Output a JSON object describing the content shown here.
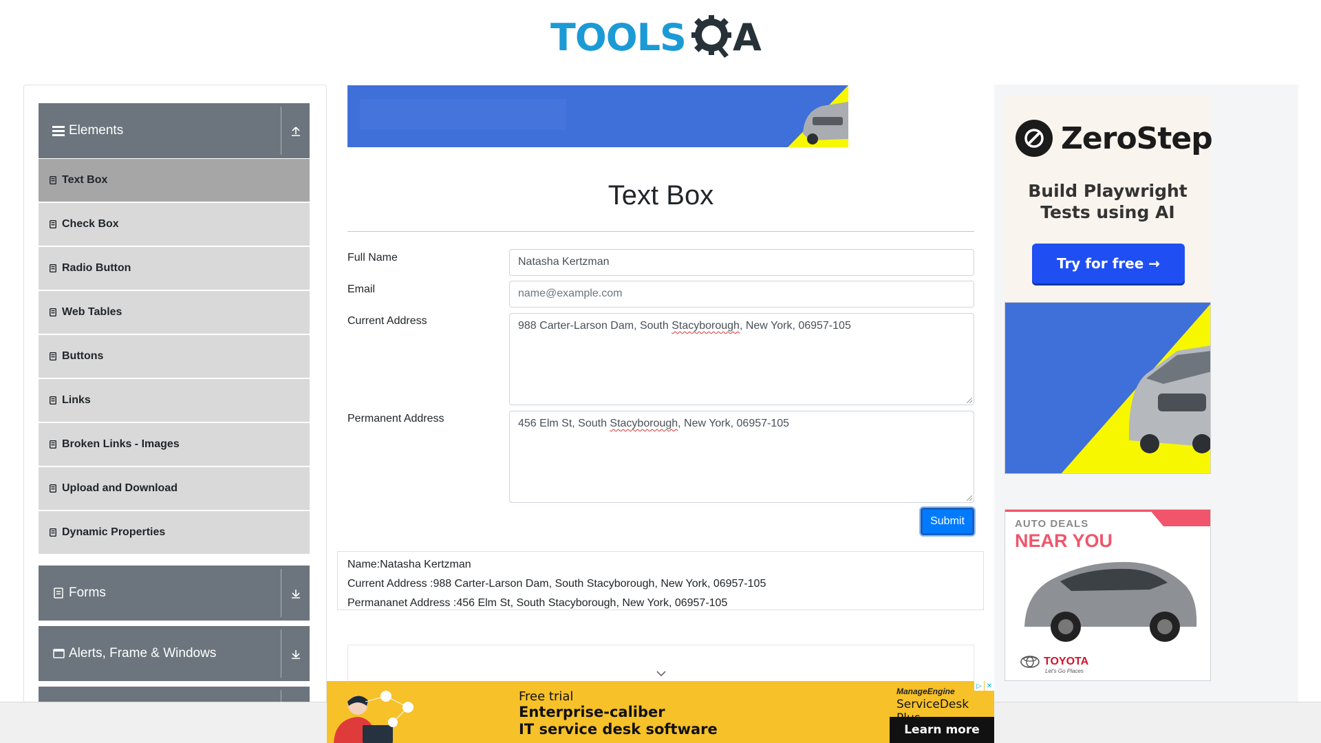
{
  "header": {
    "logo_primary": "TOOLS",
    "logo_secondary": "A",
    "logo_icon": "gear-magnifier-icon"
  },
  "sidebar": {
    "groups": [
      {
        "label": "Elements",
        "icon": "hamburger-icon",
        "toggle_icon": "collapse-up-icon",
        "expanded": true
      },
      {
        "label": "Forms",
        "icon": "document-icon",
        "toggle_icon": "expand-down-icon",
        "expanded": false
      },
      {
        "label": "Alerts, Frame & Windows",
        "icon": "window-icon",
        "toggle_icon": "expand-down-icon",
        "expanded": false
      }
    ],
    "items": [
      {
        "label": "Text Box",
        "active": true
      },
      {
        "label": "Check Box",
        "active": false
      },
      {
        "label": "Radio Button",
        "active": false
      },
      {
        "label": "Web Tables",
        "active": false
      },
      {
        "label": "Buttons",
        "active": false
      },
      {
        "label": "Links",
        "active": false
      },
      {
        "label": "Broken Links - Images",
        "active": false
      },
      {
        "label": "Upload and Download",
        "active": false
      },
      {
        "label": "Dynamic Properties",
        "active": false
      }
    ]
  },
  "main": {
    "title": "Text Box",
    "form": {
      "full_name_label": "Full Name",
      "full_name_value": "Natasha Kertzman",
      "email_label": "Email",
      "email_placeholder": "name@example.com",
      "current_address_label": "Current Address",
      "current_address_parts": [
        "988 Carter-Larson Dam, South ",
        "Stacyborough",
        ", New York, 06957-105"
      ],
      "permanent_address_label": "Permanent Address",
      "permanent_address_parts": [
        "456 Elm St, South ",
        "Stacyborough",
        ", New York, 06957-105"
      ],
      "submit_label": "Submit"
    },
    "output": {
      "name_line": "Name:Natasha Kertzman",
      "current_address_line": "Current Address :988 Carter-Larson Dam, South Stacyborough, New York, 06957-105",
      "permanent_address_line": "Permananet Address :456 Elm St, South Stacyborough, New York, 06957-105"
    }
  },
  "ads": {
    "zerostep": {
      "brand": "ZeroStep",
      "tagline_line1": "Build Playwright",
      "tagline_line2": "Tests using AI",
      "cta": "Try for free →"
    },
    "toyota": {
      "eyebrow": "AUTO DEALS",
      "title": "NEAR YOU",
      "brand": "TOYOTA",
      "slogan": "Let's Go Places"
    },
    "banner": {
      "eyebrow": "Free trial",
      "headline_line1": "Enterprise-caliber",
      "headline_line2": "IT service desk software",
      "brand_small": "ManageEngine",
      "brand": "ServiceDesk Plus",
      "cta": "Learn more"
    }
  },
  "colors": {
    "accent": "#007bff",
    "sidebar_header": "#6c757d",
    "sidebar_item": "#d9d9d9",
    "sidebar_item_active": "#a6a6a6",
    "logo_blue": "#1c9ad6",
    "ad_blue": "#3f6fd8",
    "ad_yellow": "#f7f700",
    "banner_yellow": "#f7c12a"
  }
}
